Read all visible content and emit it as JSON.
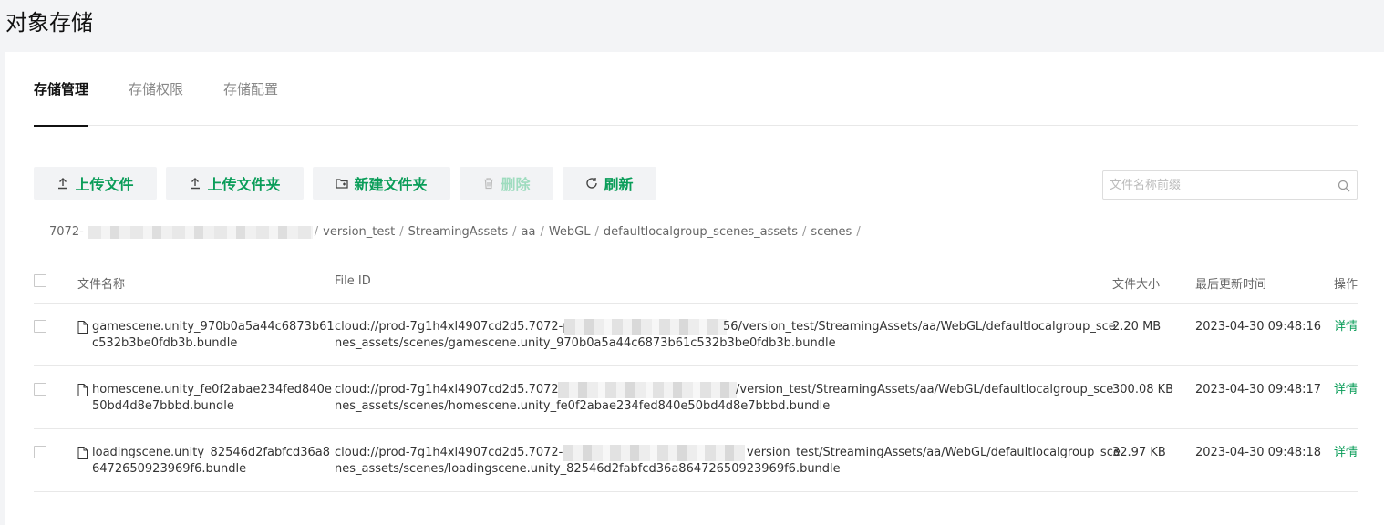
{
  "page": {
    "title": "对象存储"
  },
  "tabs": [
    {
      "label": "存储管理",
      "active": true
    },
    {
      "label": "存储权限",
      "active": false
    },
    {
      "label": "存储配置",
      "active": false
    }
  ],
  "toolbar": {
    "upload_file": "上传文件",
    "upload_folder": "上传文件夹",
    "new_folder": "新建文件夹",
    "delete": "删除",
    "refresh": "刷新"
  },
  "search": {
    "placeholder": "文件名称前缀"
  },
  "breadcrumb": {
    "root_visible": "7072-",
    "items": [
      "version_test",
      "StreamingAssets",
      "aa",
      "WebGL",
      "defaultlocalgroup_scenes_assets",
      "scenes"
    ],
    "separator": "/"
  },
  "table": {
    "headers": {
      "name": "文件名称",
      "file_id": "File ID",
      "size": "文件大小",
      "updated": "最后更新时间",
      "action": "操作"
    },
    "rows": [
      {
        "name_line1": "gamescene.unity_970b0a5a44c6873b61",
        "name_line2": "c532b3be0fdb3b.bundle",
        "id_line1_start": "cloud://prod-7g1h4xl4907cd2d5.7072-prod",
        "id_line1_end": "56/version_test/StreamingAssets/aa/WebGL/defaultlocalgroup_sce",
        "id_line2": "nes_assets/scenes/gamescene.unity_970b0a5a44c6873b61c532b3be0fdb3b.bundle",
        "size": "2.20 MB",
        "updated": "2023-04-30 09:48:16",
        "action": "详情"
      },
      {
        "name_line1": "homescene.unity_fe0f2abae234fed840e",
        "name_line2": "50bd4d8e7bbbd.bundle",
        "id_line1_start": "cloud://prod-7g1h4xl4907cd2d5.7072-pro",
        "id_line1_end": "/version_test/StreamingAssets/aa/WebGL/defaultlocalgroup_sce",
        "id_line2": "nes_assets/scenes/homescene.unity_fe0f2abae234fed840e50bd4d8e7bbbd.bundle",
        "size": "300.08 KB",
        "updated": "2023-04-30 09:48:17",
        "action": "详情"
      },
      {
        "name_line1": "loadingscene.unity_82546d2fabfcd36a8",
        "name_line2": "6472650923969f6.bundle",
        "id_line1_start": "cloud://prod-7g1h4xl4907cd2d5.7072-proc",
        "id_line1_end": "version_test/StreamingAssets/aa/WebGL/defaultlocalgroup_sce",
        "id_line2": "nes_assets/scenes/loadingscene.unity_82546d2fabfcd36a86472650923969f6.bundle",
        "size": "32.97 KB",
        "updated": "2023-04-30 09:48:18",
        "action": "详情"
      }
    ]
  },
  "colors": {
    "accent": "#0a9d59",
    "accent_disabled": "#9fdcbf",
    "page_bg": "#f3f4f6"
  }
}
